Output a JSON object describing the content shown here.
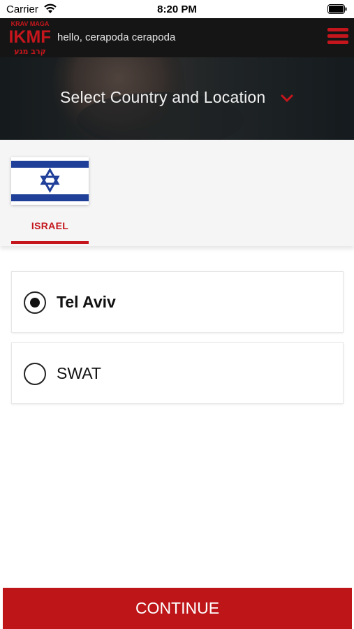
{
  "status_bar": {
    "carrier": "Carrier",
    "time": "8:20 PM",
    "icons": [
      "wifi-icon",
      "battery-icon"
    ]
  },
  "header": {
    "logo": {
      "top_text": "KRAV MAGA",
      "main_text": "IKMF",
      "hebrew_text": "קרב מגע"
    },
    "greeting": "hello, cerapoda cerapoda",
    "menu_icon": "hamburger-menu-icon"
  },
  "banner": {
    "title": "Select Country and Location",
    "icon": "chevron-down-icon"
  },
  "countries": [
    {
      "name": "ISRAEL",
      "flag": "israel-flag",
      "selected": true
    }
  ],
  "locations": [
    {
      "label": "Tel Aviv",
      "selected": true
    },
    {
      "label": "SWAT",
      "selected": false
    }
  ],
  "footer": {
    "continue_label": "CONTINUE"
  },
  "colors": {
    "accent": "#c4161c",
    "header_bg": "#151515",
    "continue_bg": "#bd1518",
    "flag_blue": "#1f3f99"
  }
}
